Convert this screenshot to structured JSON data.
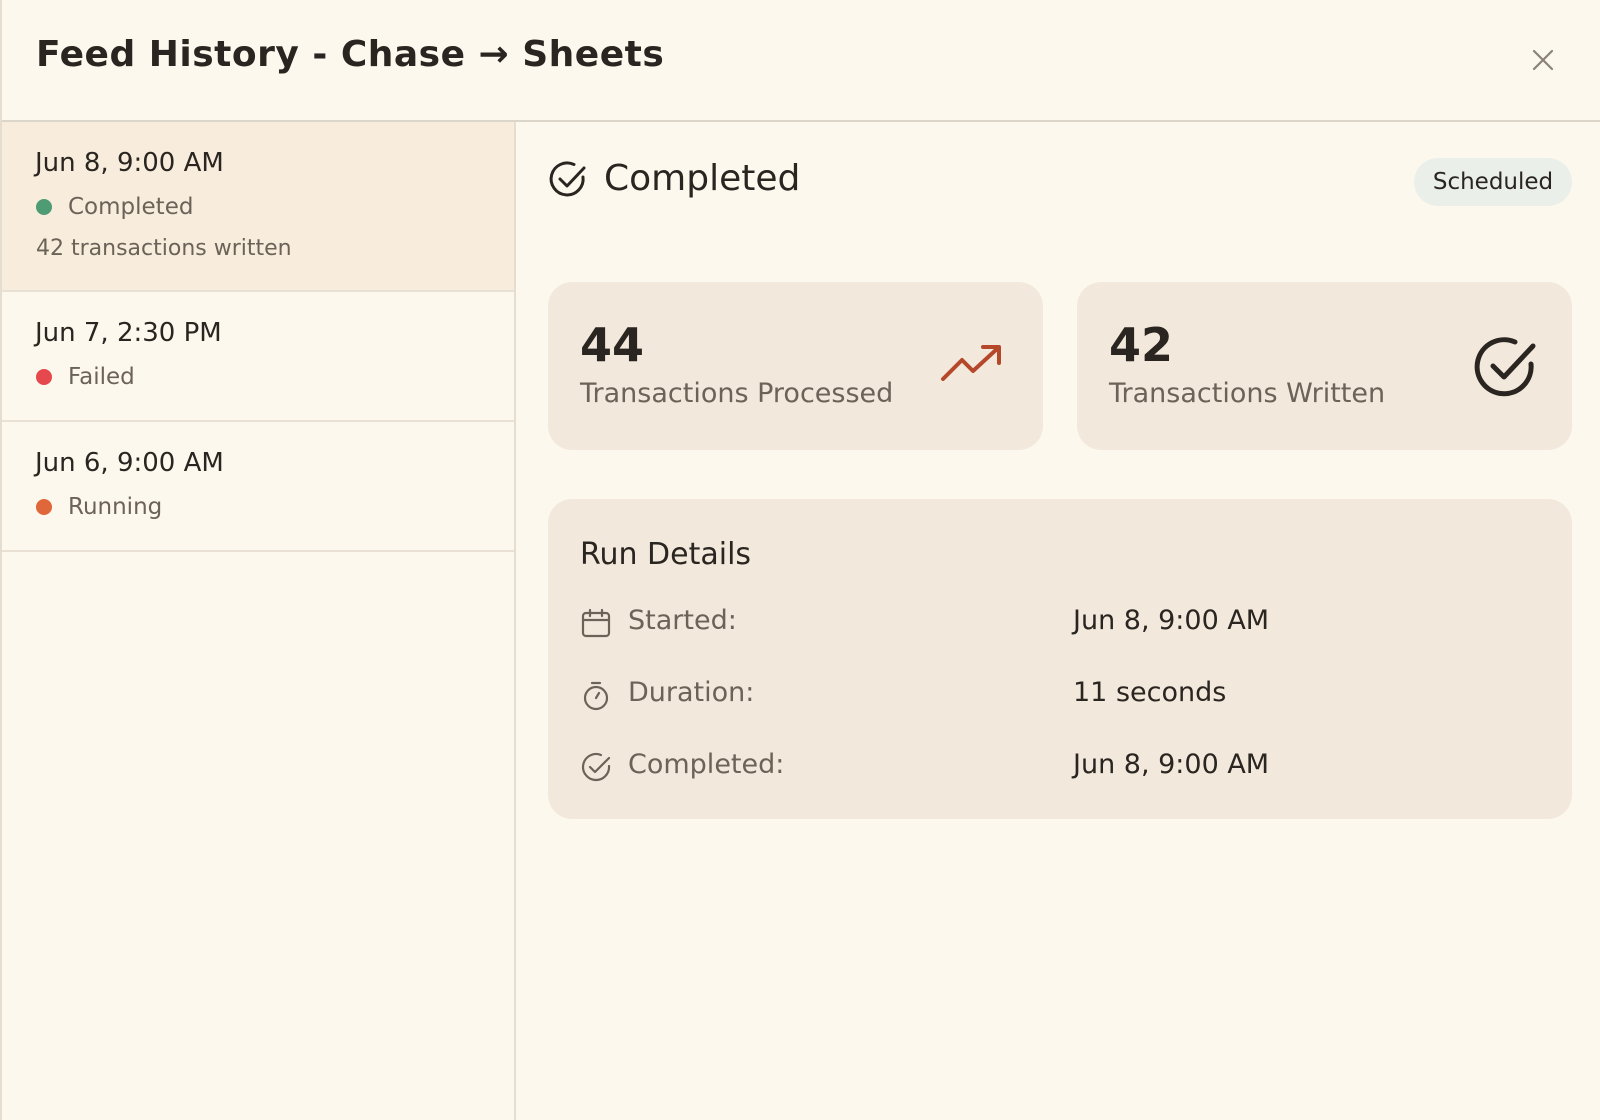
{
  "header": {
    "title": "Feed History - Chase → Sheets",
    "close_icon": "close-icon"
  },
  "runs": [
    {
      "date": "Jun 8, 9:00 AM",
      "status": "Completed",
      "status_color": "#4e9b74",
      "note": "42 transactions written",
      "selected": true
    },
    {
      "date": "Jun 7, 2:30 PM",
      "status": "Failed",
      "status_color": "#e5484d",
      "note": "",
      "selected": false
    },
    {
      "date": "Jun 6, 9:00 AM",
      "status": "Running",
      "status_color": "#e0673a",
      "note": "",
      "selected": false
    }
  ],
  "detail": {
    "status_label": "Completed",
    "status_icon": "check-circle-icon",
    "trigger_badge": "Scheduled",
    "stats": [
      {
        "value": "44",
        "label": "Transactions Processed",
        "icon": "trending-up-icon",
        "icon_color": "#b5482a"
      },
      {
        "value": "42",
        "label": "Transactions Written",
        "icon": "check-circle-icon",
        "icon_color": "#2a2520"
      }
    ],
    "run_details": {
      "heading": "Run Details",
      "rows": [
        {
          "label": "Started:",
          "value": "Jun 8, 9:00 AM",
          "icon": "calendar-icon"
        },
        {
          "label": "Duration:",
          "value": "11 seconds",
          "icon": "stopwatch-icon"
        },
        {
          "label": "Completed:",
          "value": "Jun 8, 9:00 AM",
          "icon": "check-circle-icon"
        }
      ]
    }
  },
  "colors": {
    "background": "#fdf8ee",
    "selected_row": "#f8eddd",
    "card": "#f2e9dc",
    "badge": "#eaefe9"
  }
}
